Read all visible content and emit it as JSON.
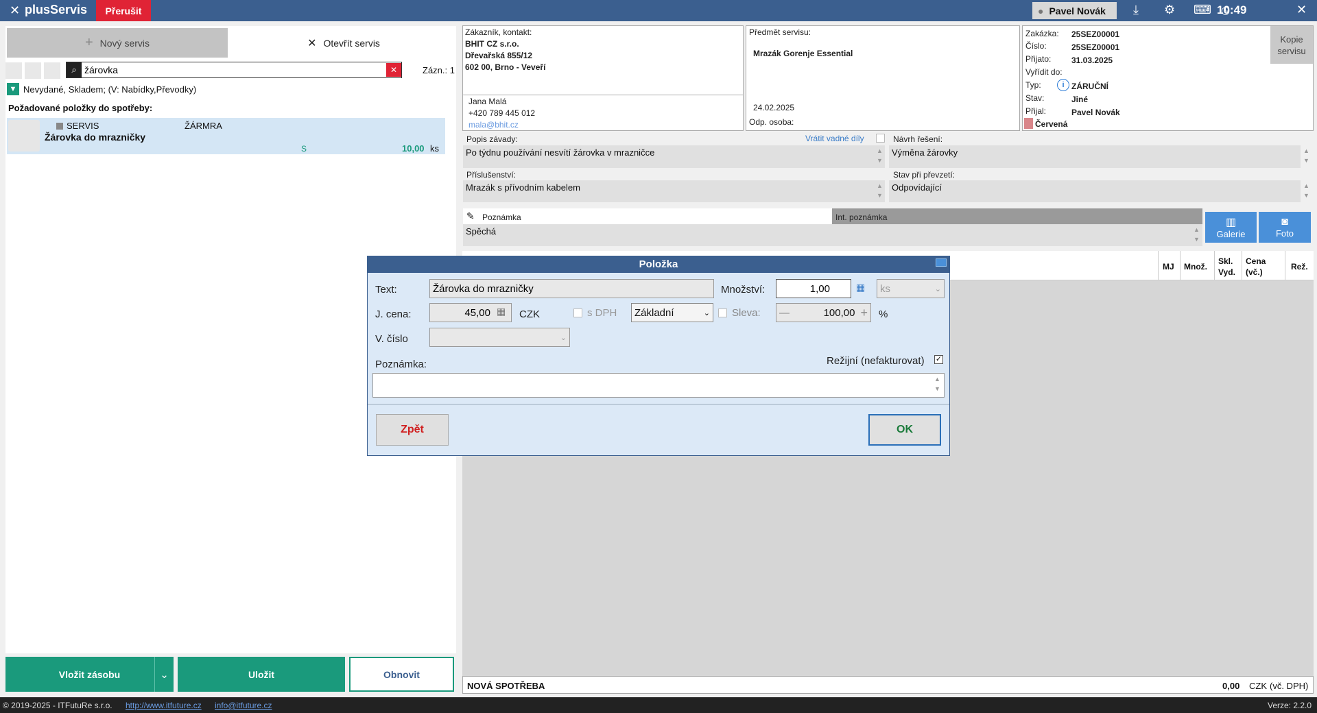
{
  "titlebar": {
    "app_name": "plusServis",
    "abort_label": "Přerušit",
    "user_name": "Pavel Novák",
    "time": "10:49"
  },
  "left": {
    "new_service": "Nový servis",
    "open_service": "Otevřít servis",
    "search_value": "žárovka",
    "records_label": "Zázn.: 1",
    "filter_text": "Nevydané, Skladem; (V: Nabídky,Převodky)",
    "requested_title": "Požadované položky do spotřeby:",
    "item": {
      "category": "SERVIS",
      "code": "ŽÁRMRA",
      "name": "Žárovka do mrazničky",
      "stock_flag": "S",
      "qty": "10,00",
      "unit": "ks"
    },
    "insert_stock": "Vložit zásobu",
    "save": "Uložit",
    "refresh": "Obnovit"
  },
  "customer": {
    "label": "Zákazník, kontakt:",
    "company": "BHIT CZ s.r.o.",
    "street": "Dřevařská 855/12",
    "city": "602 00, Brno - Veveří",
    "contact_name": "Jana Malá",
    "phone": "+420 789 445 012",
    "email": "mala@bhit.cz"
  },
  "subject": {
    "label": "Předmět servisu:",
    "value": "Mrazák Gorenje Essential",
    "date": "24.02.2025",
    "resp_label": "Odp. osoba:"
  },
  "order": {
    "order_label": "Zakázka:",
    "order_value": "25SEZ00001",
    "num_label": "Číslo:",
    "num_value": "25SEZ00001",
    "received_label": "Přijato:",
    "received_value": "31.03.2025",
    "due_label": "Vyřídit do:",
    "type_label": "Typ:",
    "type_value": "ZÁRUČNÍ",
    "state_label": "Stav:",
    "state_value": "Jiné",
    "accepted_label": "Přijal:",
    "accepted_value": "Pavel Novák",
    "color_value": "Červená",
    "copy_label": "Kopie servisu",
    "color_hex": "#d9868a"
  },
  "details": {
    "fault_label": "Popis závady:",
    "return_parts_label": "Vrátit vadné díly",
    "fault_value": "Po týdnu používání nesvítí žárovka v mrazničce",
    "solution_label": "Návrh řešení:",
    "solution_value": "Výměna žárovky",
    "accessories_label": "Příslušenství:",
    "accessories_value": "Mrazák s přívodním kabelem",
    "condition_label": "Stav při převzetí:",
    "condition_value": "Odpovídající",
    "note_tab": "Poznámka",
    "int_note_tab": "Int. poznámka",
    "note_value": "Spěchá",
    "gallery": "Galerie",
    "photo": "Foto"
  },
  "table": {
    "columns": [
      "MJ",
      "Množ.",
      "Skl. Vyd.",
      "Cena (vč.)",
      "Rež."
    ]
  },
  "footer": {
    "label": "NOVÁ SPOTŘEBA",
    "total": "0,00",
    "currency": "CZK",
    "vat_note": "(vč. DPH)"
  },
  "dialog": {
    "title": "Položka",
    "text_label": "Text:",
    "text_value": "Žárovka do mrazničky",
    "qty_label": "Množství:",
    "qty_value": "1,00",
    "unit_value": "ks",
    "price_label": "J. cena:",
    "price_value": "45,00",
    "currency": "CZK",
    "vat_label": "s DPH",
    "price_type": "Základní",
    "discount_label": "Sleva:",
    "discount_value": "100,00",
    "percent": "%",
    "vnum_label": "V. číslo",
    "overhead_label": "Režijní (nefakturovat)",
    "note_label": "Poznámka:",
    "back": "Zpět",
    "ok": "OK"
  },
  "status": {
    "copyright": "© 2019-2025 - ITFutuRe s.r.o.",
    "website": "http://www.itfuture.cz",
    "email": "info@itfuture.cz",
    "version": "Verze: 2.2.0"
  }
}
